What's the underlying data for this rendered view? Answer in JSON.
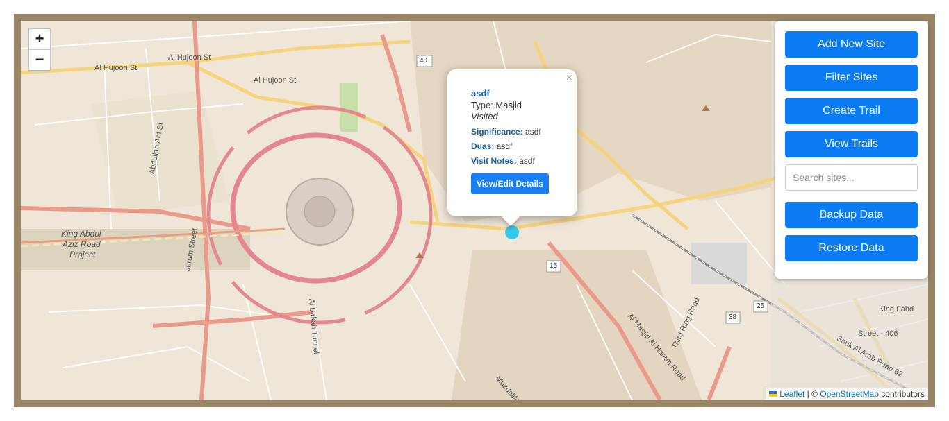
{
  "map": {
    "zoom_in": "+",
    "zoom_out": "−",
    "labels": {
      "hujoon1": "Al Hujoon St",
      "hujoon2": "Al Hujoon St",
      "hujoon3": "Al Hujoon St",
      "king_abdul": "King Abdul",
      "aziz_road": "Aziz Road",
      "project": "Project",
      "jurum": "Jurum Street",
      "birkah": "Al Birkah Tunnel",
      "masjid_haram": "Al Masjid Al Haram Road",
      "third_ring": "Third Ring Road",
      "king_fahd": "King Fahd",
      "souk": "Souk Al Arab Road 62",
      "street406": "Street - 406",
      "route40": "40",
      "route15": "15",
      "route25": "25",
      "route38": "38",
      "abdullah": "Abdullah Arif St",
      "muzdalifah": "Muzdalifah"
    }
  },
  "popup": {
    "close": "×",
    "name": "asdf",
    "type": "Type: Masjid",
    "status": "Visited",
    "significance_label": "Significance:",
    "significance_value": " asdf",
    "duas_label": "Duas:",
    "duas_value": " asdf",
    "notes_label": "Visit Notes:",
    "notes_value": " asdf",
    "button": "View/Edit Details"
  },
  "panel": {
    "add_site": "Add New Site",
    "filter_sites": "Filter Sites",
    "create_trail": "Create Trail",
    "view_trails": "View Trails",
    "search_placeholder": "Search sites...",
    "backup": "Backup Data",
    "restore": "Restore Data"
  },
  "attribution": {
    "leaflet": "Leaflet",
    "separator": " | © ",
    "osm": "OpenStreetMap",
    "contributors": " contributors"
  },
  "colors": {
    "primary_button": "#0a7bf2",
    "frame": "#9a8466",
    "marker": "#25c4f0"
  }
}
